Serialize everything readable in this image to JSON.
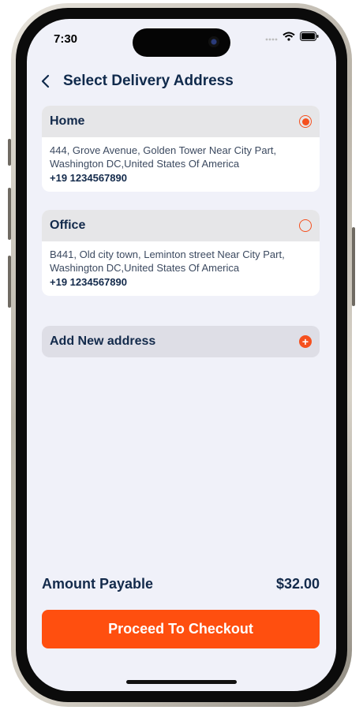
{
  "status_bar": {
    "time": "7:30"
  },
  "header": {
    "title": "Select Delivery Address",
    "back_icon": "chevron-left-icon"
  },
  "addresses": [
    {
      "label": "Home",
      "address": "444, Grove Avenue, Golden Tower Near City Part, Washington DC,United States Of America",
      "phone": "+19 1234567890",
      "selected": true
    },
    {
      "label": "Office",
      "address": "B441, Old city town, Leminton street Near City Part, Washington DC,United States Of America",
      "phone": "+19 1234567890",
      "selected": false
    }
  ],
  "add_address": {
    "label": "Add New address",
    "icon": "plus-circle-icon"
  },
  "summary": {
    "label": "Amount Payable",
    "value": "$32.00"
  },
  "checkout": {
    "label": "Proceed To Checkout"
  },
  "colors": {
    "accent": "#ff4f0f",
    "text_dark": "#132a4b",
    "background": "#f0f1f9"
  }
}
